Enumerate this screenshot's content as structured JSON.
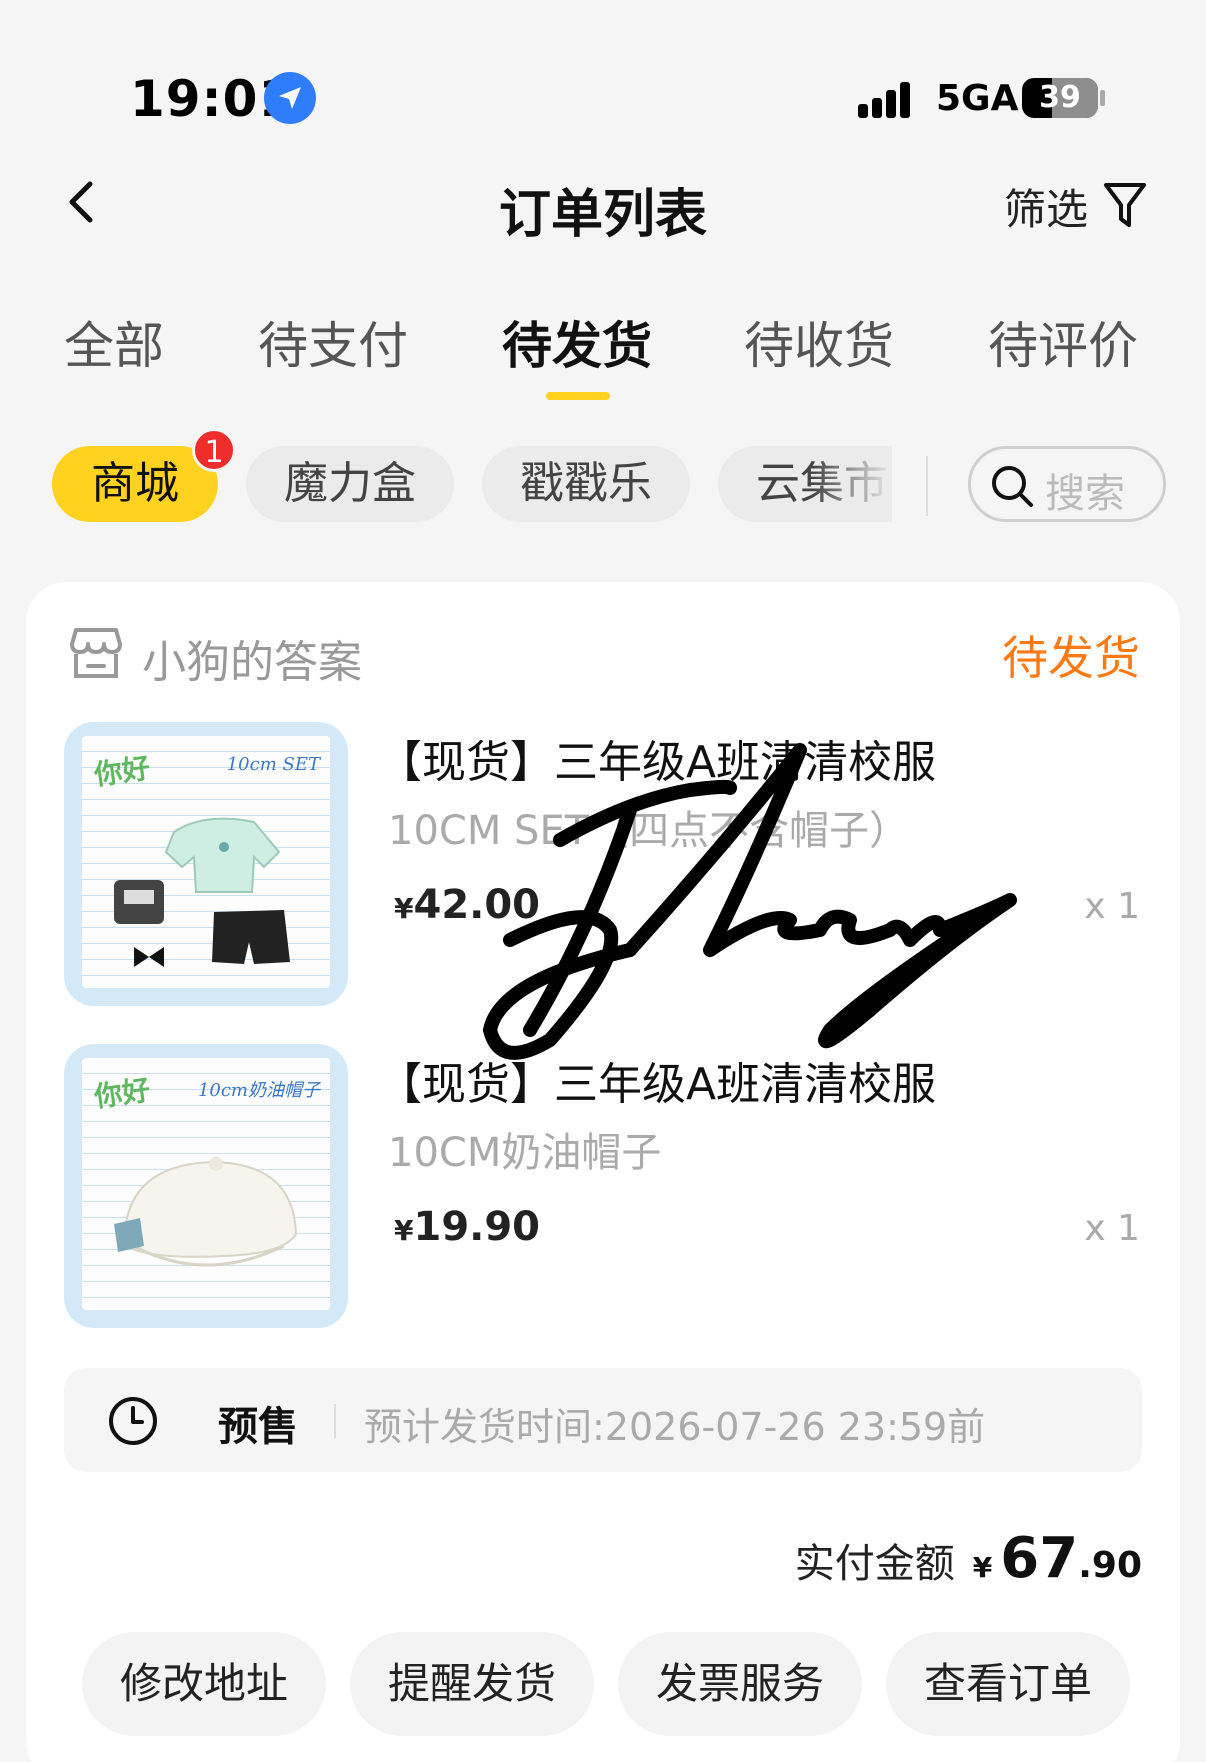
{
  "status_bar": {
    "time": "19:01",
    "network": "5GA",
    "battery": "39"
  },
  "header": {
    "title": "订单列表",
    "filter_label": "筛选"
  },
  "tabs": [
    {
      "label": "全部"
    },
    {
      "label": "待支付"
    },
    {
      "label": "待发货"
    },
    {
      "label": "待收货"
    },
    {
      "label": "待评价"
    }
  ],
  "active_tab": "待发货",
  "chips": [
    {
      "label": "商城",
      "badge": "1"
    },
    {
      "label": "魔力盒"
    },
    {
      "label": "戳戳乐"
    },
    {
      "label": "云集市"
    }
  ],
  "search": {
    "placeholder": "搜索"
  },
  "order": {
    "shop_name": "小狗的答案",
    "status": "待发货",
    "items": [
      {
        "title": "【现货】三年级A班清清校服",
        "spec": "10CM SET（四点不含帽子）",
        "price": "42.00",
        "currency": "¥",
        "qty": "x 1",
        "thumb_hello": "你好",
        "thumb_tag": "10cm SET"
      },
      {
        "title": "【现货】三年级A班清清校服",
        "spec": "10CM奶油帽子",
        "price": "19.90",
        "currency": "¥",
        "qty": "x 1",
        "thumb_hello": "你好",
        "thumb_tag": "10cm奶油帽子"
      }
    ],
    "presale": {
      "label": "预售",
      "text": "预计发货时间:2026-07-26 23:59前"
    },
    "total": {
      "label": "实付金额",
      "currency": "¥",
      "integer": "67",
      "decimal": ".90"
    },
    "actions": [
      {
        "label": "修改地址"
      },
      {
        "label": "提醒发货"
      },
      {
        "label": "发票服务"
      },
      {
        "label": "查看订单"
      }
    ]
  },
  "colors": {
    "accent_yellow": "#ffd21f",
    "status_orange": "#ff7a14",
    "badge_red": "#ef2d2d",
    "location_blue": "#2f7dfa"
  }
}
